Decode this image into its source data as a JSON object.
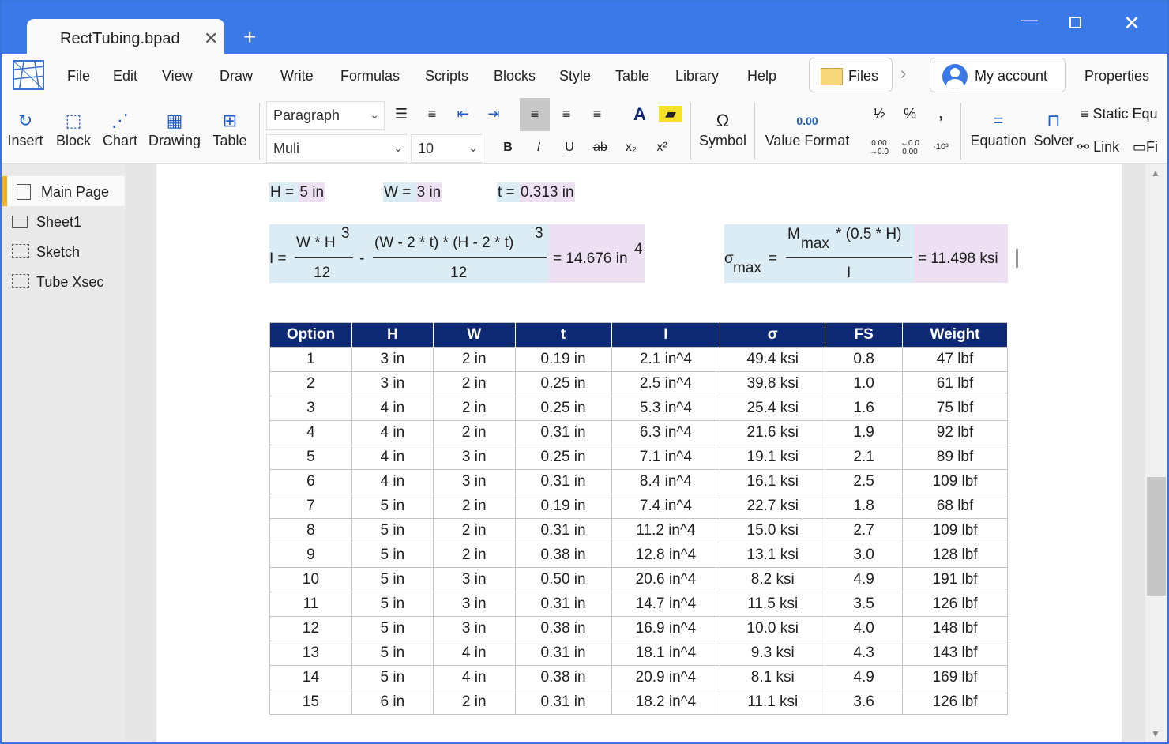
{
  "window": {
    "tab_title": "RectTubing.bpad",
    "close_glyph": "✕",
    "new_tab_glyph": "+"
  },
  "menu": {
    "items": [
      "File",
      "Edit",
      "View",
      "Draw",
      "Write",
      "Formulas",
      "Scripts",
      "Blocks",
      "Style",
      "Table",
      "Library",
      "Help"
    ],
    "files_label": "Files",
    "account_label": "My account",
    "properties_label": "Properties"
  },
  "toolbar": {
    "insert": "Insert",
    "block": "Block",
    "chart": "Chart",
    "drawing": "Drawing",
    "table": "Table",
    "paragraph_style": "Paragraph",
    "font": "Muli",
    "font_size": "10",
    "symbol": "Symbol",
    "value_format": "Value Format",
    "value_format_sample": "0.00",
    "fraction": "½",
    "percent": "%",
    "comma": ",",
    "dec_inc": "0.00 →0.0",
    "dec_dec": "←0.0 0.00",
    "exp": "·10³",
    "equation": "Equation",
    "solver": "Solver",
    "static_eq": "Static Equ",
    "link": "Link",
    "fig": "Fi",
    "bold": "B",
    "italic": "I",
    "underline": "U",
    "strike": "ab",
    "subscript": "x₂",
    "superscript": "x²",
    "font_color": "A"
  },
  "pages": [
    {
      "label": "Main Page",
      "active": true
    },
    {
      "label": "Sheet1",
      "active": false
    },
    {
      "label": "Sketch",
      "active": false
    },
    {
      "label": "Tube Xsec",
      "active": false
    }
  ],
  "variables": [
    {
      "name": "H = ",
      "value": "5 in"
    },
    {
      "name": "W = ",
      "value": "3 in"
    },
    {
      "name": "t = ",
      "value": "0.313 in"
    }
  ],
  "formula_I": {
    "lhs": "I =",
    "num1": "W * H",
    "num1_exp": "3",
    "den1": "12",
    "minus": "-",
    "num2": "(W - 2 * t) * (H - 2 * t)",
    "num2_exp": "3",
    "den2": "12",
    "result": "= 14.676 in",
    "result_exp": "4"
  },
  "formula_sigma": {
    "lhs": "σ",
    "lhs_sub": "max",
    "eq": "=",
    "num_base": "M",
    "num_sub": "max",
    "num_rest": "* (0.5 * H)",
    "den": "I",
    "result": "= 11.498 ksi"
  },
  "table": {
    "headers": [
      "Option",
      "H",
      "W",
      "t",
      "I",
      "σ",
      "FS",
      "Weight"
    ],
    "rows": [
      [
        "1",
        "3 in",
        "2 in",
        "0.19 in",
        "2.1 in^4",
        "49.4 ksi",
        "0.8",
        "47 lbf"
      ],
      [
        "2",
        "3 in",
        "2 in",
        "0.25 in",
        "2.5 in^4",
        "39.8 ksi",
        "1.0",
        "61 lbf"
      ],
      [
        "3",
        "4 in",
        "2 in",
        "0.25 in",
        "5.3 in^4",
        "25.4 ksi",
        "1.6",
        "75 lbf"
      ],
      [
        "4",
        "4 in",
        "2 in",
        "0.31 in",
        "6.3 in^4",
        "21.6 ksi",
        "1.9",
        "92 lbf"
      ],
      [
        "5",
        "4 in",
        "3 in",
        "0.25 in",
        "7.1 in^4",
        "19.1 ksi",
        "2.1",
        "89 lbf"
      ],
      [
        "6",
        "4 in",
        "3 in",
        "0.31 in",
        "8.4 in^4",
        "16.1 ksi",
        "2.5",
        "109 lbf"
      ],
      [
        "7",
        "5 in",
        "2 in",
        "0.19 in",
        "7.4 in^4",
        "22.7 ksi",
        "1.8",
        "68 lbf"
      ],
      [
        "8",
        "5 in",
        "2 in",
        "0.31 in",
        "11.2 in^4",
        "15.0 ksi",
        "2.7",
        "109 lbf"
      ],
      [
        "9",
        "5 in",
        "2 in",
        "0.38 in",
        "12.8 in^4",
        "13.1 ksi",
        "3.0",
        "128 lbf"
      ],
      [
        "10",
        "5 in",
        "3 in",
        "0.50 in",
        "20.6 in^4",
        "8.2 ksi",
        "4.9",
        "191 lbf"
      ],
      [
        "11",
        "5 in",
        "3 in",
        "0.31 in",
        "14.7 in^4",
        "11.5 ksi",
        "3.5",
        "126 lbf"
      ],
      [
        "12",
        "5 in",
        "3 in",
        "0.38 in",
        "16.9 in^4",
        "10.0 ksi",
        "4.0",
        "148 lbf"
      ],
      [
        "13",
        "5 in",
        "4 in",
        "0.31 in",
        "18.1 in^4",
        "9.3 ksi",
        "4.3",
        "143 lbf"
      ],
      [
        "14",
        "5 in",
        "4 in",
        "0.38 in",
        "20.9 in^4",
        "8.1 ksi",
        "4.9",
        "169 lbf"
      ],
      [
        "15",
        "6 in",
        "2 in",
        "0.31 in",
        "18.2 in^4",
        "11.1 ksi",
        "3.6",
        "126 lbf"
      ]
    ]
  },
  "colors": {
    "titlebar": "#3c79e8",
    "table_header": "#0f2a74",
    "var_name_bg": "#dcecf4",
    "var_value_bg": "#ece0f2",
    "active_page_accent": "#f2b21b"
  }
}
